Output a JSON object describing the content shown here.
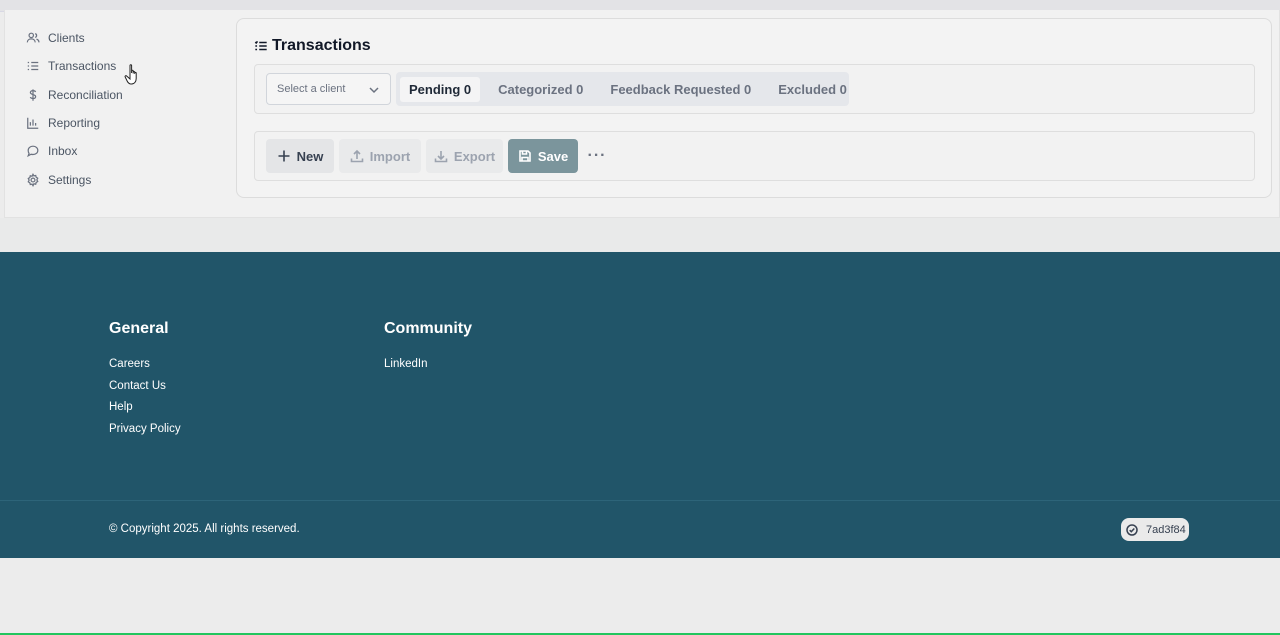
{
  "sidebar": {
    "items": [
      {
        "label": "Clients",
        "icon": "users-icon"
      },
      {
        "label": "Transactions",
        "icon": "list-icon"
      },
      {
        "label": "Reconciliation",
        "icon": "dollar-icon"
      },
      {
        "label": "Reporting",
        "icon": "bar-chart-icon"
      },
      {
        "label": "Inbox",
        "icon": "inbox-icon"
      },
      {
        "label": "Settings",
        "icon": "gear-icon"
      }
    ]
  },
  "main": {
    "title": "Transactions",
    "client_select": {
      "placeholder": "Select a client"
    },
    "tabs": [
      {
        "label": "Pending 0",
        "active": true
      },
      {
        "label": "Categorized 0",
        "active": false
      },
      {
        "label": "Feedback Requested 0",
        "active": false
      },
      {
        "label": "Excluded 0",
        "active": false
      }
    ],
    "toolbar": {
      "new_label": "New",
      "import_label": "Import",
      "export_label": "Export",
      "save_label": "Save",
      "more_label": "···"
    }
  },
  "footer": {
    "general": {
      "heading": "General",
      "links": [
        "Careers",
        "Contact Us",
        "Help",
        "Privacy Policy"
      ]
    },
    "community": {
      "heading": "Community",
      "links": [
        "LinkedIn"
      ]
    },
    "copyright": "© Copyright 2025. All rights reserved.",
    "version": "7ad3f84"
  },
  "colors": {
    "footer_bg": "#215569",
    "save_button": "#7b959c",
    "page_bg": "#ececec"
  }
}
